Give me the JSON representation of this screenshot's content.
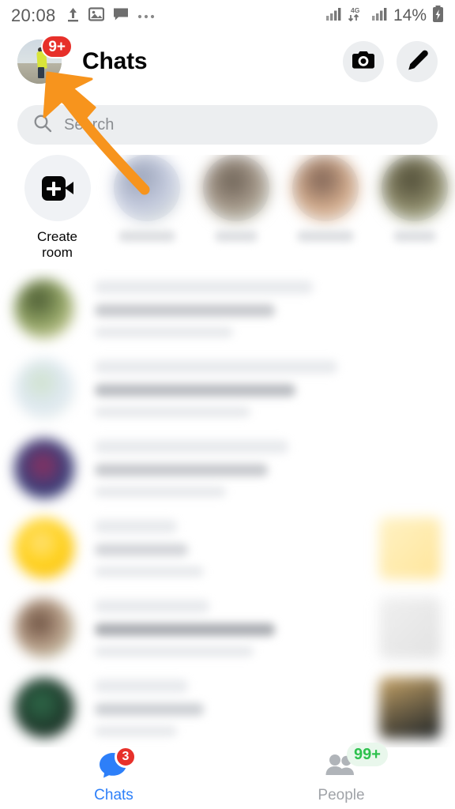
{
  "status_bar": {
    "time": "20:08",
    "battery_percent": "14%",
    "network_type": "4G",
    "left_icons": [
      "upload-icon",
      "image-icon",
      "message-icon",
      "more-icon"
    ],
    "right_icons": [
      "signal-bars-icon",
      "data-transfer-icon",
      "signal-bars-icon",
      "battery-charging-icon"
    ]
  },
  "header": {
    "title": "Chats",
    "avatar_badge": "9+",
    "avatar_icon": "profile-avatar",
    "camera_icon": "camera-icon",
    "compose_icon": "pencil-icon"
  },
  "search": {
    "placeholder": "Search",
    "icon": "search-icon"
  },
  "stories": {
    "create_room": {
      "label_line1": "Create",
      "label_line2": "room",
      "icon": "video-plus-icon"
    },
    "items": [
      {
        "name": "",
        "avatar_colors": [
          "#c9cfe2",
          "#9aa3b8",
          "#cfd8c4"
        ]
      },
      {
        "name": "",
        "avatar_colors": [
          "#d6cfc6",
          "#6b6054",
          "#cdd9c2"
        ]
      },
      {
        "name": "",
        "avatar_colors": [
          "#e8d9cf",
          "#7a5f52",
          "#f0dcc8"
        ]
      },
      {
        "name": "",
        "avatar_colors": [
          "#cfd2c0",
          "#4d4a35",
          "#d8e2c6"
        ]
      },
      {
        "name": "",
        "avatar_colors": [
          "#cddbe8",
          "#6d86a0",
          "#b9c9da"
        ]
      }
    ]
  },
  "chat_list": {
    "rows": [
      {
        "avatar_colors": [
          "#f0ecc0",
          "#4a5a33",
          "#cfe0bb"
        ],
        "has_thumb": false,
        "thumb_colors": []
      },
      {
        "avatar_colors": [
          "#dfe9f2",
          "#cfe2cc",
          "#eaf0e4"
        ],
        "has_thumb": false,
        "thumb_colors": []
      },
      {
        "avatar_colors": [
          "#3b3f7a",
          "#8e2f5e",
          "#2c2f63"
        ],
        "has_thumb": false,
        "thumb_colors": []
      },
      {
        "avatar_colors": [
          "#ffd21e",
          "#f5b60a",
          "#ffe27a"
        ],
        "has_thumb": true,
        "thumb_colors": [
          "#fff2c4",
          "#ffe59a"
        ]
      },
      {
        "avatar_colors": [
          "#b9a08a",
          "#6b4f3f",
          "#cfe0c4"
        ],
        "has_thumb": true,
        "thumb_colors": [
          "#f0f0f0",
          "#e2e2e2"
        ]
      },
      {
        "avatar_colors": [
          "#1f3a2c",
          "#2f6b4a",
          "#14261d"
        ],
        "has_thumb": true,
        "thumb_colors": [
          "#caa76a",
          "#1d2327"
        ]
      }
    ]
  },
  "bottom_nav": {
    "items": [
      {
        "label": "Chats",
        "icon": "chat-bubble-icon",
        "badge": "3",
        "badge_type": "red",
        "active": true
      },
      {
        "label": "People",
        "icon": "people-icon",
        "badge": "99+",
        "badge_type": "green",
        "active": false
      }
    ]
  },
  "annotation": {
    "arrow_color": "#f7941d",
    "arrow_target": "profile-avatar"
  }
}
